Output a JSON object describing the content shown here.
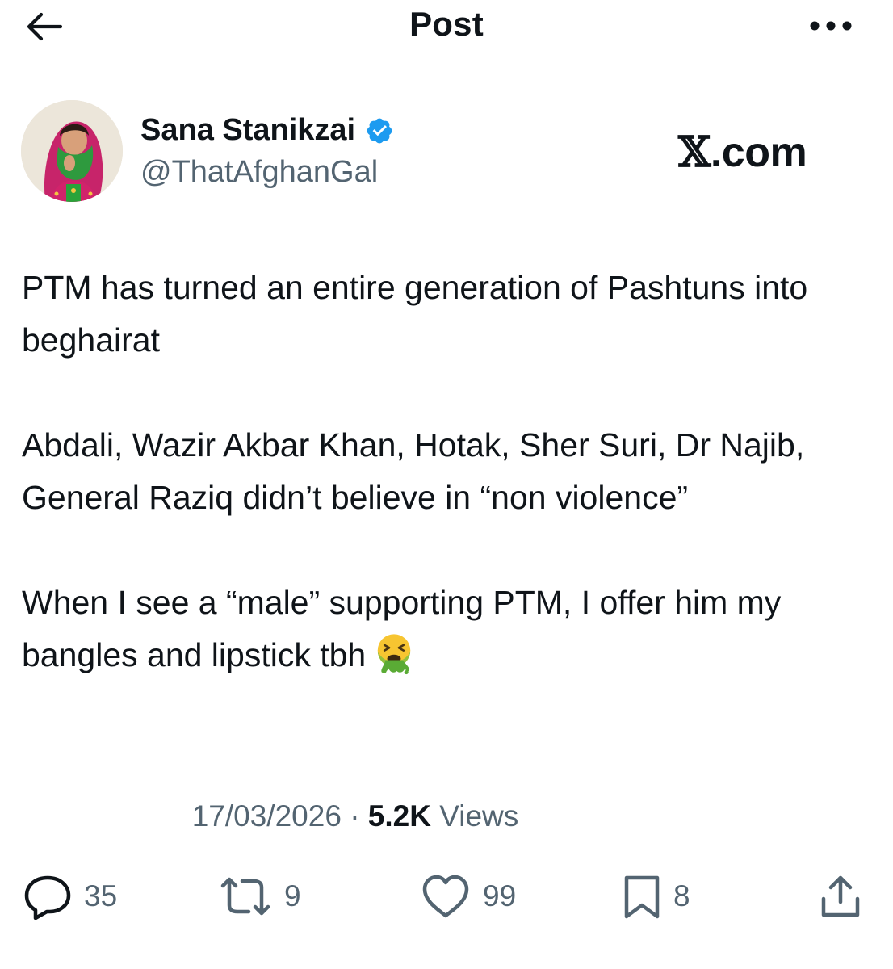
{
  "header": {
    "title": "Post"
  },
  "author": {
    "name": "Sana Stanikzai",
    "handle": "@ThatAfghanGal",
    "verified": true,
    "verified_color": "#1d9bf0"
  },
  "watermark": {
    "x": "𝕏",
    "suffix": ".com"
  },
  "post": {
    "text": "PTM has turned an entire generation of Pashtuns into beghairat\n\nAbdali, Wazir Akbar Khan, Hotak, Sher Suri, Dr Najib, General Raziq didn’t believe in “non violence”\n\nWhen I see a “male” supporting PTM, I offer him my bangles and lipstick tbh",
    "emoji": "nauseated-face"
  },
  "meta": {
    "date": "17/03/2026",
    "separator": "·",
    "views_count": "5.2K",
    "views_label": "Views"
  },
  "actions": {
    "replies": "35",
    "reposts": "9",
    "likes": "99",
    "bookmarks": "8"
  },
  "colors": {
    "text_primary": "#0f1419",
    "text_secondary": "#536471",
    "accent": "#1d9bf0"
  },
  "icons": [
    "back-arrow-icon",
    "more-icon",
    "verified-badge-icon",
    "reply-icon",
    "repost-icon",
    "like-icon",
    "bookmark-icon",
    "share-icon"
  ]
}
